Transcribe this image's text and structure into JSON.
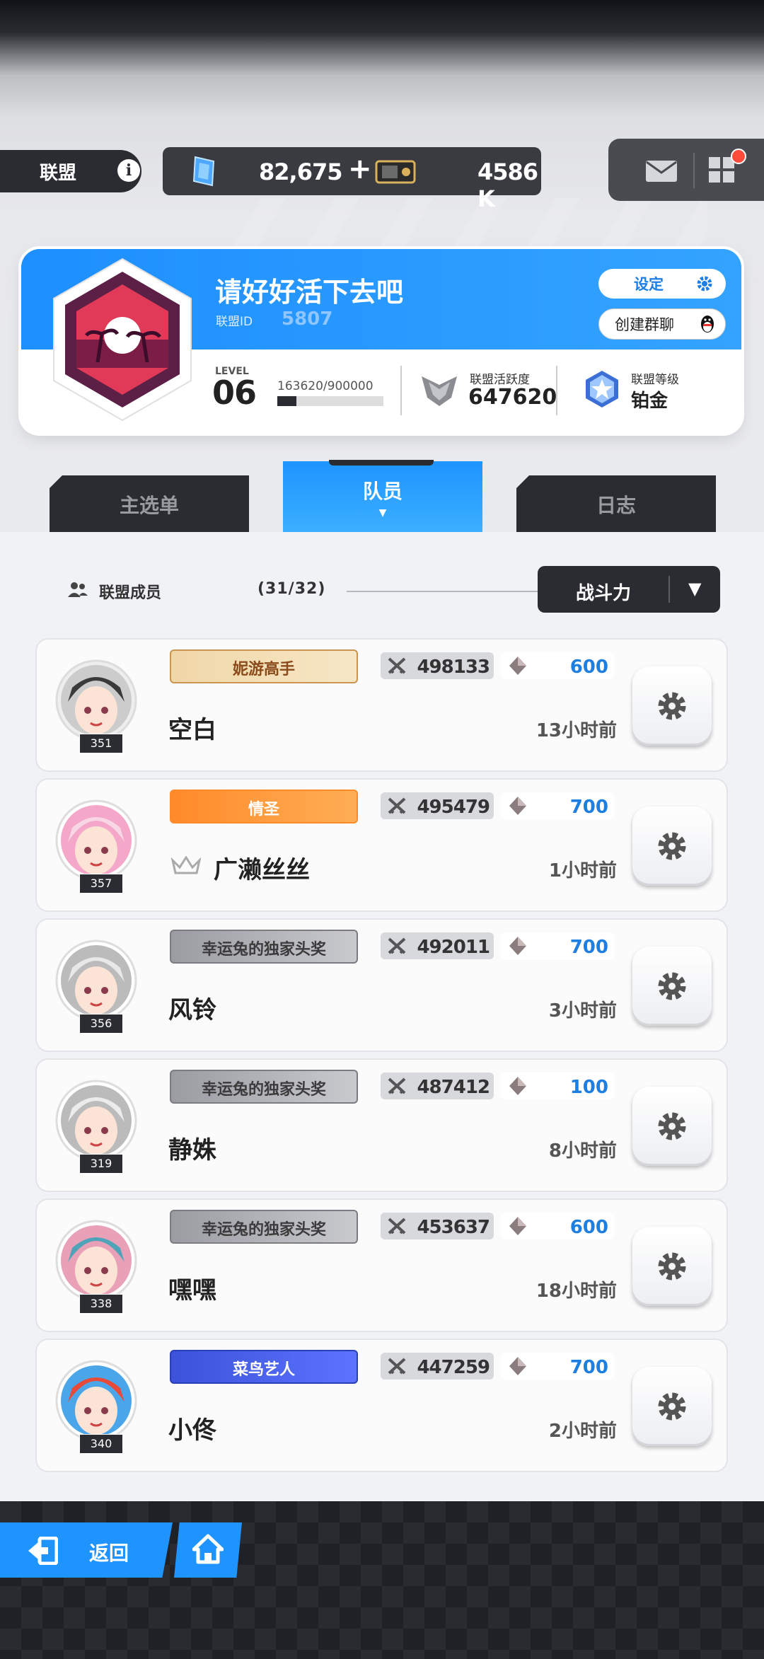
{
  "topbar": {
    "alliance_label": "联盟",
    "gem_value": "82,675",
    "plus": "+",
    "ticket_value": "4586 K"
  },
  "guild": {
    "name": "请好好活下去吧",
    "id_label": "联盟ID",
    "id_value": "5807",
    "settings_label": "设定",
    "group_chat_label": "创建群聊",
    "level_label": "LEVEL",
    "level_value": "06",
    "exp_text": "163620/900000",
    "exp_progress": 0.18,
    "activity_label": "联盟活跃度",
    "activity_value": "647620",
    "rank_label": "联盟等级",
    "rank_value": "铂金"
  },
  "tabs": [
    {
      "label": "主选单"
    },
    {
      "label": "队员"
    },
    {
      "label": "日志"
    }
  ],
  "members_header": {
    "label": "联盟成员",
    "count": "(31/32)",
    "sort_label": "战斗力"
  },
  "members": [
    {
      "name": "空白",
      "level": "351",
      "title": "妮游高手",
      "power": "498133",
      "contrib": "600",
      "last_online": "13小时前"
    },
    {
      "name": "广濑丝丝",
      "level": "357",
      "title": "情圣",
      "power": "495479",
      "contrib": "700",
      "last_online": "1小时前"
    },
    {
      "name": "风铃",
      "level": "356",
      "title": "幸运兔的独家头奖",
      "power": "492011",
      "contrib": "700",
      "last_online": "3小时前"
    },
    {
      "name": "静姝",
      "level": "319",
      "title": "幸运兔的独家头奖",
      "power": "487412",
      "contrib": "100",
      "last_online": "8小时前"
    },
    {
      "name": "嘿嘿",
      "level": "338",
      "title": "幸运兔的独家头奖",
      "power": "453637",
      "contrib": "600",
      "last_online": "18小时前"
    },
    {
      "name": "小佟",
      "level": "340",
      "title": "菜鸟艺人",
      "power": "447259",
      "contrib": "700",
      "last_online": "2小时前"
    }
  ],
  "bottom": {
    "back_label": "返回"
  },
  "colors": {
    "accent": "#1f94ff",
    "dark": "#2b2c31",
    "contrib_text": "#1e7fe0"
  }
}
